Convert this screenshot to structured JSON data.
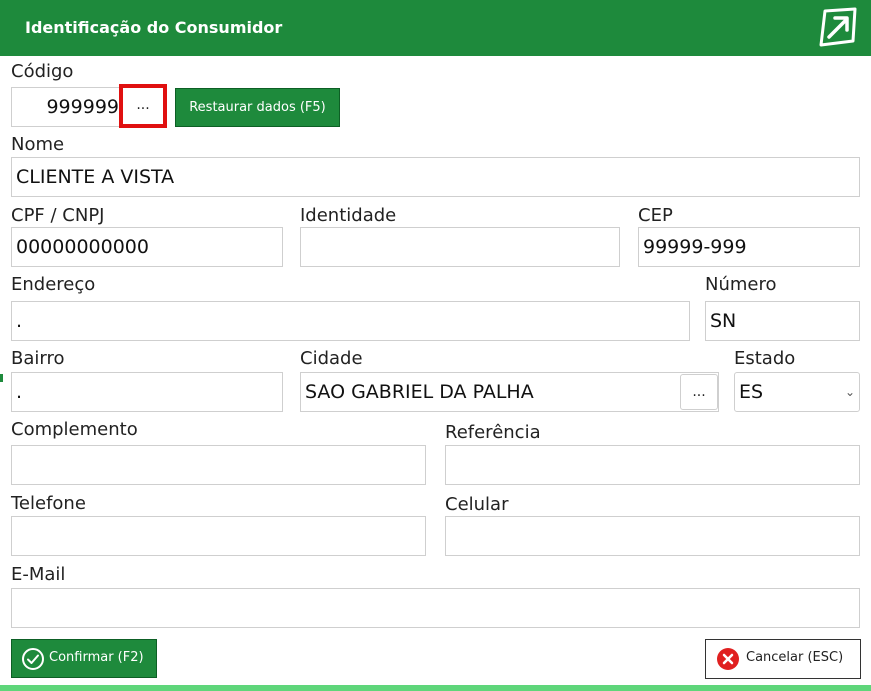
{
  "window": {
    "title": "Identificação do Consumidor",
    "logo_icon": "arrow-box-icon",
    "accent": "#1e8a3c"
  },
  "codigo": {
    "label": "Código",
    "value": "999999",
    "search_label": "...",
    "restore_label": "Restaurar dados (F5)"
  },
  "nome": {
    "label": "Nome",
    "value": "CLIENTE A VISTA"
  },
  "cpf": {
    "label": "CPF / CNPJ",
    "value": "00000000000"
  },
  "identidade": {
    "label": "Identidade",
    "value": ""
  },
  "cep": {
    "label": "CEP",
    "value": "99999-999"
  },
  "endereco": {
    "label": "Endereço",
    "value": "."
  },
  "numero": {
    "label": "Número",
    "value": "SN"
  },
  "bairro": {
    "label": "Bairro",
    "value": "."
  },
  "cidade": {
    "label": "Cidade",
    "value": "SAO GABRIEL DA PALHA",
    "search_label": "..."
  },
  "estado": {
    "label": "Estado",
    "value": "ES"
  },
  "complemento": {
    "label": "Complemento",
    "value": ""
  },
  "referencia": {
    "label": "Referência",
    "value": ""
  },
  "telefone": {
    "label": "Telefone",
    "value": ""
  },
  "celular": {
    "label": "Celular",
    "value": ""
  },
  "email": {
    "label": "E-Mail",
    "value": ""
  },
  "actions": {
    "confirm_label": "Confirmar (F2)",
    "cancel_label": "Cancelar (ESC)",
    "confirm_icon": "check-circle-icon",
    "cancel_icon": "close-circle-icon"
  }
}
